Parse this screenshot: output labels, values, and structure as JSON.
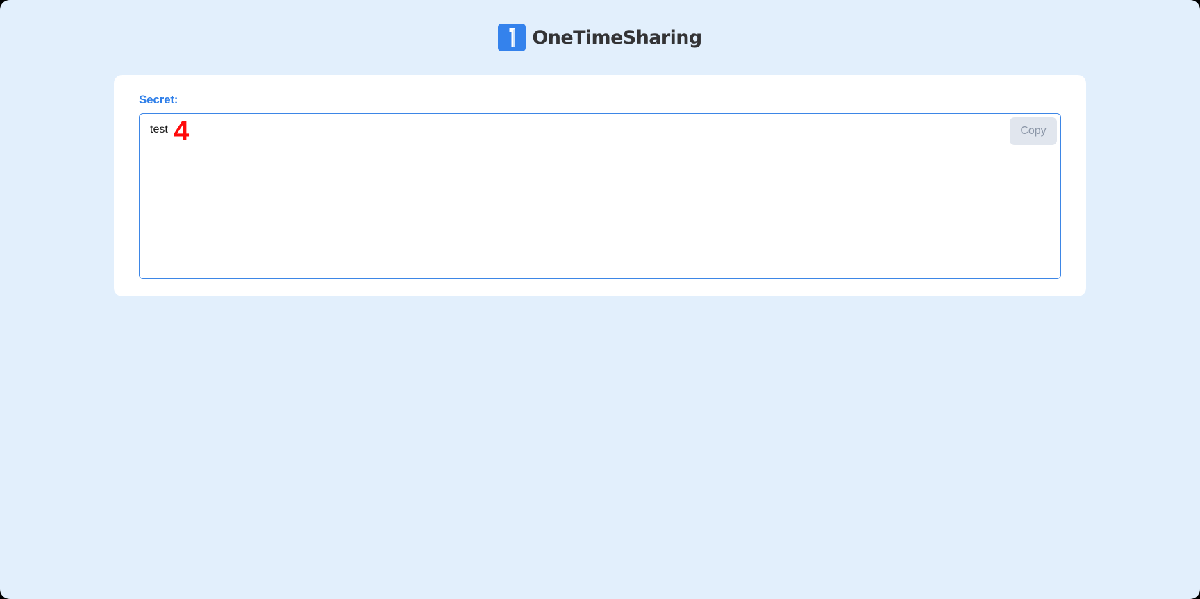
{
  "header": {
    "logo_icon": "number-one-logo-icon",
    "brand_name": "OneTimeSharing"
  },
  "secret": {
    "label": "Secret:",
    "value": "test",
    "copy_label": "Copy"
  },
  "annotation": {
    "marker": "4"
  },
  "colors": {
    "background": "#e2effc",
    "accent": "#3482ec",
    "label": "#2f7fe9",
    "marker": "#ff0a0a",
    "copy_button_bg": "#e1e6ee",
    "copy_button_text": "#8c97a8",
    "brand_text": "#333335"
  }
}
